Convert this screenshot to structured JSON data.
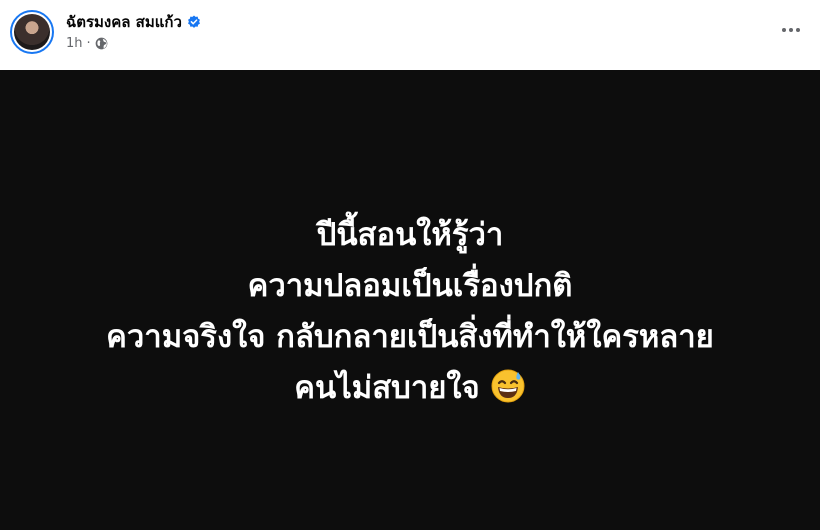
{
  "post": {
    "author": "ฉัตรมงคล สมแก้ว",
    "time": "1h",
    "separator": "·"
  },
  "icons": {
    "verified": "verified-badge-icon",
    "audience": "globe-icon",
    "more": "more-options-icon",
    "emoji": "grinning-face-with-sweat-emoji"
  },
  "colors": {
    "accent": "#1877f2",
    "image_background": "#0d0d0d",
    "image_text": "#ffffff",
    "meta_text": "#65676b"
  },
  "image_text": {
    "line1": "ปีนี้สอนให้รู้ว่า",
    "line2": "ความปลอมเป็นเรื่องปกติ",
    "line3": "ความจริงใจ กลับกลายเป็นสิ่งที่ทำให้ใครหลาย",
    "line4": "คนไม่สบายใจ"
  }
}
